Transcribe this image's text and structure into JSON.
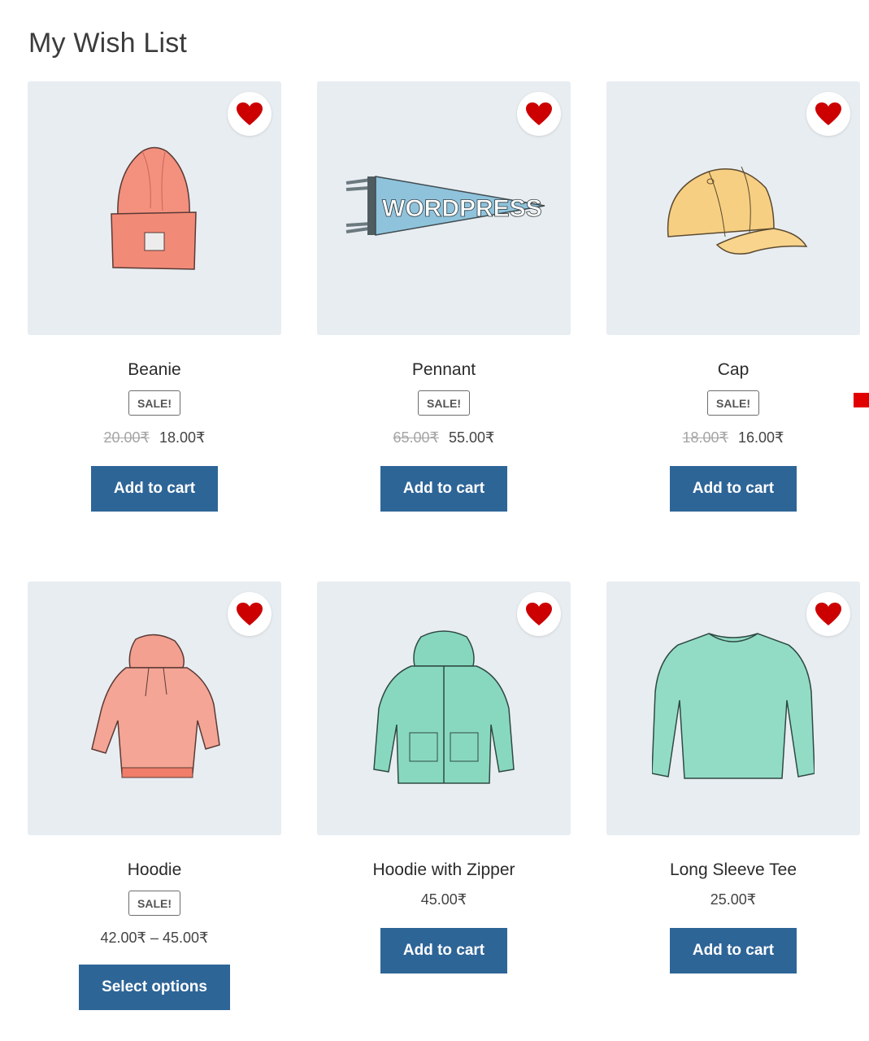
{
  "page": {
    "title": "My Wish List"
  },
  "colors": {
    "accent": "#2e6597",
    "heart": "#cc0000",
    "thumb_bg": "#e8edf1"
  },
  "products": [
    {
      "name": "Beanie",
      "badge": "SALE!",
      "old_price": "20.00₹",
      "price": "18.00₹",
      "button": "Add to cart",
      "image": "beanie-image",
      "wishlisted": true
    },
    {
      "name": "Pennant",
      "badge": "SALE!",
      "old_price": "65.00₹",
      "price": "55.00₹",
      "button": "Add to cart",
      "image": "pennant-image",
      "wishlisted": true,
      "pennant_text": "WORDPRESS"
    },
    {
      "name": "Cap",
      "badge": "SALE!",
      "old_price": "18.00₹",
      "price": "16.00₹",
      "button": "Add to cart",
      "image": "cap-image",
      "wishlisted": true
    },
    {
      "name": "Hoodie",
      "badge": "SALE!",
      "price": "42.00₹ – 45.00₹",
      "button": "Select options",
      "image": "hoodie-image",
      "wishlisted": true
    },
    {
      "name": "Hoodie with Zipper",
      "price": "45.00₹",
      "button": "Add to cart",
      "image": "hoodie-zipper-image",
      "wishlisted": true
    },
    {
      "name": "Long Sleeve Tee",
      "price": "25.00₹",
      "button": "Add to cart",
      "image": "long-sleeve-tee-image",
      "wishlisted": true
    }
  ]
}
